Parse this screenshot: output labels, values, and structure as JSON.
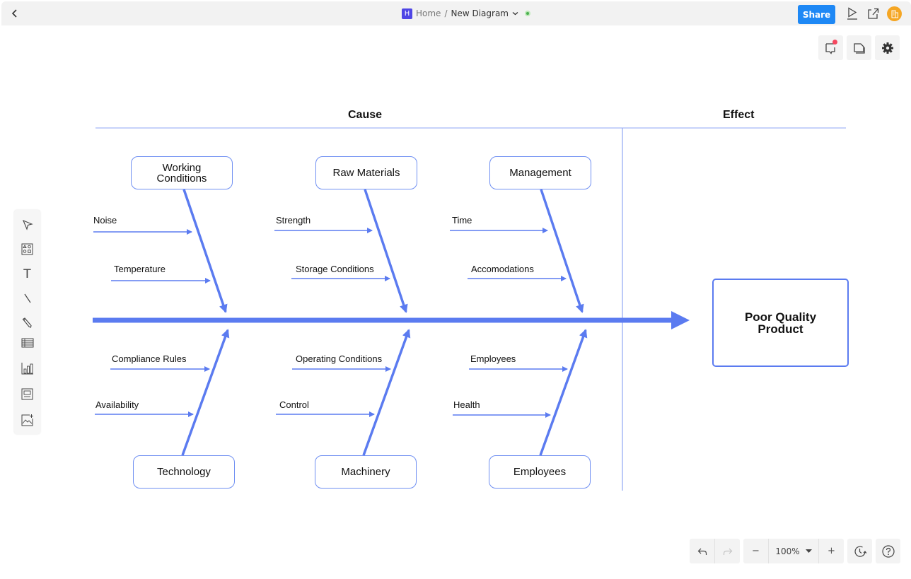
{
  "topbar": {
    "back_icon": "chevron-left-icon",
    "logo_letter": "H",
    "home_label": "Home",
    "separator": "/",
    "document_title": "New Diagram",
    "title_dropdown_icon": "chevron-down-icon",
    "save_status_icon": "saved-check-icon",
    "share_label": "Share",
    "present_icon": "play-icon",
    "export_icon": "export-icon",
    "team_icon": "building-icon"
  },
  "right_toolbar": {
    "items": [
      {
        "name": "comments",
        "icon": "comment-icon",
        "has_notification": true
      },
      {
        "name": "pages",
        "icon": "pages-icon"
      },
      {
        "name": "settings",
        "icon": "gear-icon"
      }
    ]
  },
  "tool_palette": {
    "items": [
      {
        "name": "select",
        "icon": "cursor-icon"
      },
      {
        "name": "shapes",
        "icon": "shapes-icon"
      },
      {
        "name": "text",
        "icon": "text-icon",
        "glyph": "T"
      },
      {
        "name": "line",
        "icon": "line-icon"
      },
      {
        "name": "pen",
        "icon": "pencil-icon"
      },
      {
        "name": "table",
        "icon": "table-icon"
      },
      {
        "name": "chart",
        "icon": "bar-chart-icon"
      },
      {
        "name": "frame",
        "icon": "frame-icon"
      },
      {
        "name": "image",
        "icon": "add-image-icon"
      }
    ]
  },
  "bottom_controls": {
    "undo_icon": "undo-icon",
    "redo_icon": "redo-icon",
    "zoom_out_label": "−",
    "zoom_level": "100%",
    "zoom_dropdown_icon": "caret-down-icon",
    "zoom_in_label": "+",
    "history_icon": "history-icon",
    "help_icon": "help-icon"
  },
  "diagram": {
    "cause_header": "Cause",
    "effect_header": "Effect",
    "effect": "Poor Quality Product",
    "categories_top": [
      {
        "label": "Working Conditions",
        "factors": [
          "Noise",
          "Temperature"
        ]
      },
      {
        "label": "Raw Materials",
        "factors": [
          "Strength",
          "Storage Conditions"
        ]
      },
      {
        "label": "Management",
        "factors": [
          "Time",
          "Accomodations"
        ]
      }
    ],
    "categories_bottom": [
      {
        "label": "Technology",
        "factors": [
          "Compliance Rules",
          "Availability"
        ]
      },
      {
        "label": "Machinery",
        "factors": [
          "Operating Conditions",
          "Control"
        ]
      },
      {
        "label": "Employees",
        "factors": [
          "Employees",
          "Health"
        ]
      }
    ],
    "colors": {
      "line": "#5b7bf0",
      "thin_line": "#6f8ff2",
      "divider": "#8fa6f4"
    }
  }
}
